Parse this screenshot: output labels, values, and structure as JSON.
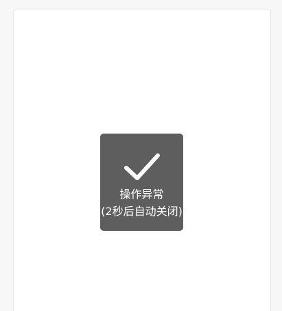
{
  "toast": {
    "icon": "checkmark-icon",
    "message": "操作异常",
    "subtext": "(2秒后自动关闭)"
  },
  "colors": {
    "page_background": "#f7f7f7",
    "panel_background": "#ffffff",
    "toast_background": "#5e5e5e",
    "toast_text": "#ffffff"
  }
}
